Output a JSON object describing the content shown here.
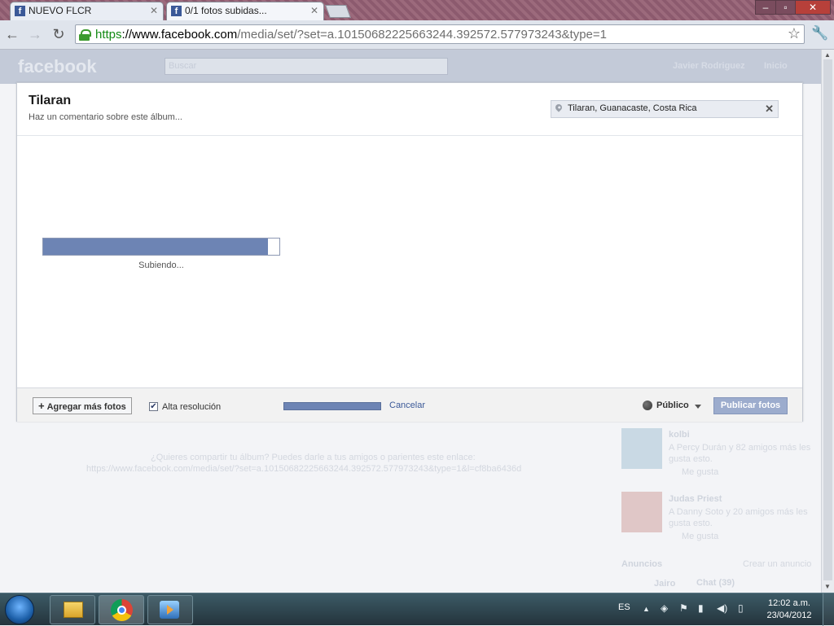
{
  "browser": {
    "tabs": [
      {
        "title": "NUEVO FLCR",
        "icon": "facebook-icon"
      },
      {
        "title": "0/1 fotos subidas...",
        "icon": "facebook-icon"
      }
    ],
    "url": {
      "protocol": "https",
      "host": "://www.facebook.com",
      "path": "/media/set/?set=a.10150682225663244.392572.577973243&type=1"
    }
  },
  "facebook_bg": {
    "logo": "facebook",
    "search_placeholder": "Buscar",
    "user": "Javier Rodriguez",
    "home": "Inicio",
    "share_prompt": "¿Quieres compartir tu álbum? Puedes darle a tus amigos o parientes este enlace:",
    "share_link": "https://www.facebook.com/media/set/?set=a.10150682225663244.392572.577973243&type=1&l=cf8ba6436d",
    "ads": [
      {
        "name": "kolbi",
        "text1": "A Percy Durán y 82 amigos más les",
        "text2": "gusta esto.",
        "like": "Me gusta"
      },
      {
        "name": "Judas Priest",
        "text1": "A Danny Soto y 20 amigos más les",
        "text2": "gusta esto.",
        "like": "Me gusta"
      }
    ],
    "ads_header": "Anuncios",
    "ads_create": "Crear un anuncio",
    "chat": "Chat (39)",
    "chat_user": "Jairo"
  },
  "dialog": {
    "album_title": "Tilaran",
    "comment_placeholder": "Haz un comentario sobre este álbum...",
    "location": "Tilaran, Guanacaste, Costa Rica",
    "upload_progress": 0.95,
    "uploading_text": "Subiendo...",
    "add_more_label": "Agregar más fotos",
    "high_res_label": "Alta resolución",
    "high_res_checked": true,
    "cancel_label": "Cancelar",
    "privacy_label": "Público",
    "publish_label": "Publicar fotos"
  },
  "taskbar": {
    "language": "ES",
    "time": "12:02 a.m.",
    "date": "23/04/2012"
  },
  "colors": {
    "fb_blue": "#3b5998",
    "progress_fill": "#6d84b4",
    "publish_disabled": "#9caccd"
  }
}
